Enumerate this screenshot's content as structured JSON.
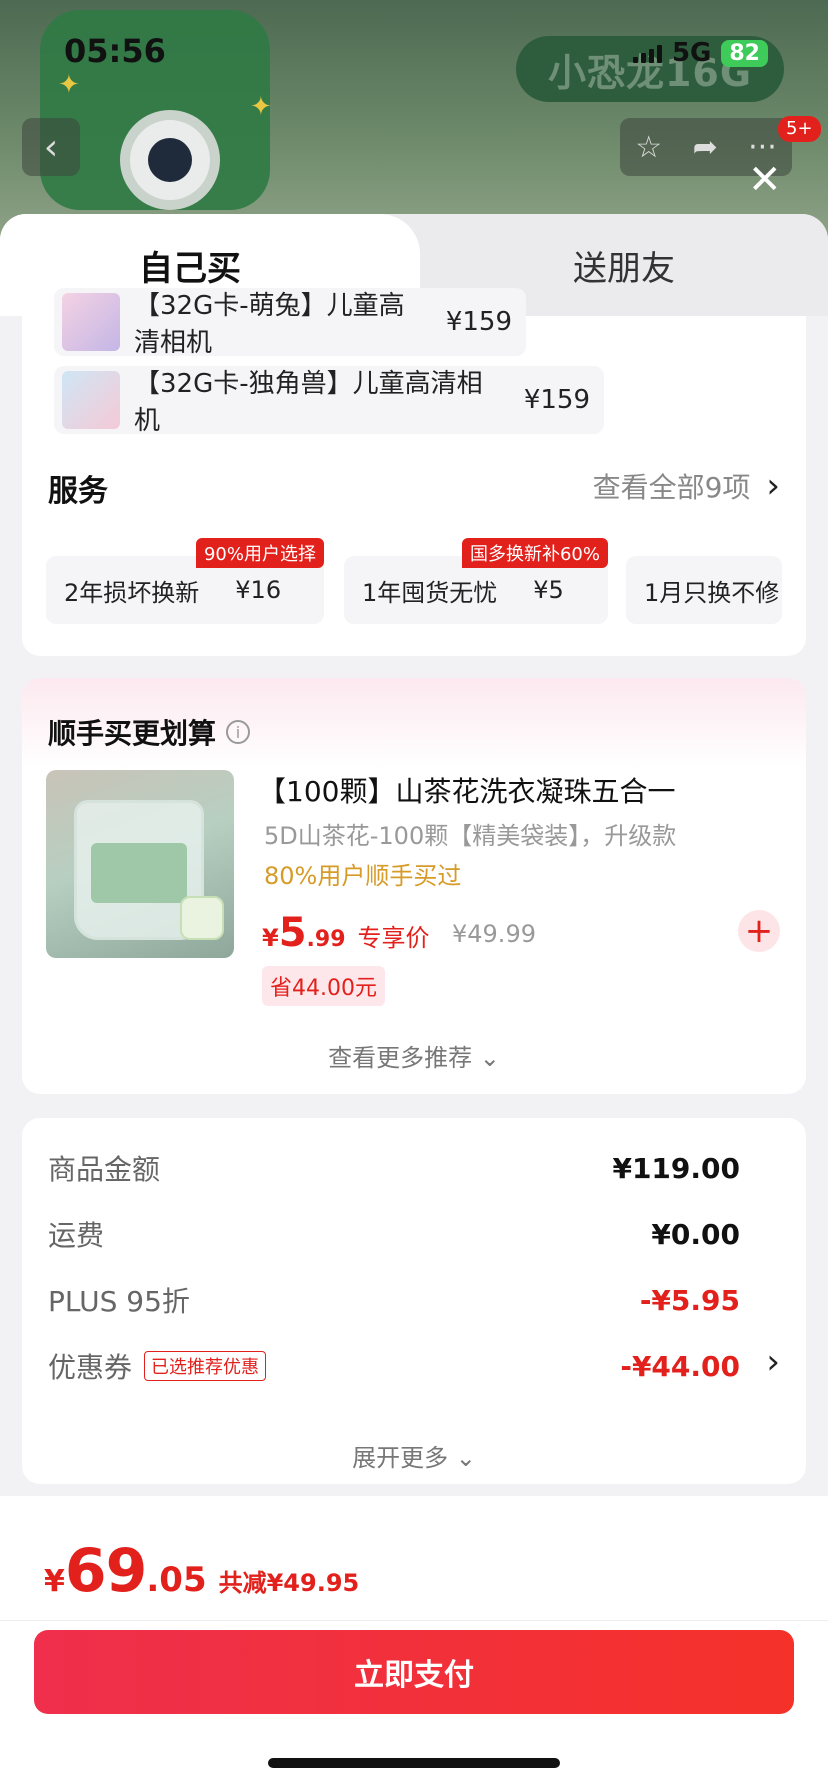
{
  "status_bar": {
    "time": "05:56",
    "network": "5G",
    "battery": "82"
  },
  "backdrop": {
    "product_title": "小恐龙16G",
    "badge": "5+"
  },
  "tabs": {
    "self_buy": "自己买",
    "gift": "送朋友"
  },
  "variants": [
    {
      "name": "【32G卡-萌兔】儿童高清相机",
      "price": "¥159"
    },
    {
      "name": "【32G卡-独角兽】儿童高清相机",
      "price": "¥159"
    }
  ],
  "services": {
    "title": "服务",
    "view_all": "查看全部9项",
    "items": [
      {
        "name": "2年损坏换新",
        "price": "¥16",
        "tag": "90%用户选择"
      },
      {
        "name": "1年囤货无忧",
        "price": "¥5",
        "tag": "国多换新补60%"
      },
      {
        "name": "1月只换不修",
        "price": "",
        "tag": ""
      }
    ]
  },
  "addon": {
    "title": "顺手买更划算",
    "product": {
      "name": "【100颗】山茶花洗衣凝珠五合一",
      "sub": "5D山茶花-100颗【精美袋装】，升级款",
      "hint": "80%用户顺手买过",
      "price_symbol": "¥",
      "price_int": "5",
      "price_dec": ".99",
      "price_tag": "专享价",
      "original_price": "¥49.99",
      "save": "省44.00元"
    },
    "more": "查看更多推荐"
  },
  "summary": {
    "goods_label": "商品金额",
    "goods_value": "¥119.00",
    "shipping_label": "运费",
    "shipping_value": "¥0.00",
    "plus_label": "PLUS 95折",
    "plus_value": "-¥5.95",
    "coupon_label": "优惠券",
    "coupon_tag": "已选推荐优惠",
    "coupon_value": "-¥44.00",
    "expand": "展开更多"
  },
  "footer": {
    "total_symbol": "¥",
    "total_int": "69",
    "total_dec": ".05",
    "reduction": "共减¥49.95",
    "pay_button": "立即支付"
  }
}
